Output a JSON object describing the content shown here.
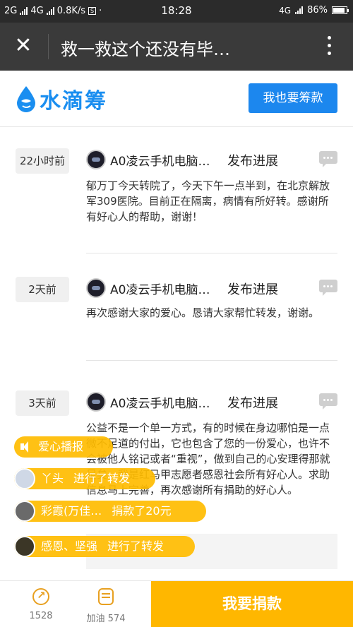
{
  "status_bar": {
    "network_1": "2G",
    "network_2": "4G",
    "speed": "0.8K/s",
    "s_badge": "S",
    "time": "18:28",
    "network_3": "4G",
    "battery": "86%"
  },
  "titlebar": {
    "close_icon": "close-icon",
    "title": "救一救这个还没有毕…",
    "more_icon": "more-vertical-icon"
  },
  "header": {
    "brand": "水滴筹",
    "raise_button": "我也要筹款",
    "accent_color": "#1c87ee"
  },
  "feed": [
    {
      "time": "22小时前",
      "user": "A0凌云手机电脑…",
      "action": "发布进展",
      "text": "郁万丁今天转院了，今天下午一点半到，在北京解放军309医院。目前正在隔离，病情有所好转。感谢所有好心人的帮助，谢谢！"
    },
    {
      "time": "2天前",
      "user": "A0凌云手机电脑…",
      "action": "发布进展",
      "text": "再次感谢大家的爱心。恳请大家帮忙转发，谢谢。"
    },
    {
      "time": "3天前",
      "user": "A0凌云手机电脑…",
      "action": "发布进展",
      "text": "公益不是一个单一方式，有的时候在身边哪怕是一点微不足道的付出，它也包含了您的一份爱心，也许不会被他人铭记或者“重视”，做到自己的心安理得那就足矣。我是红马甲志愿者感恩社会所有好心人。求助信息马上完善，再次感谢所有捐助的好心人。"
    }
  ],
  "broadcast": {
    "title": "爱心播报",
    "items": [
      {
        "name": "丫头",
        "event": "进行了转发"
      },
      {
        "name": "彩霞(万佳…",
        "event": "捐款了20元"
      },
      {
        "name": "感恩、坚强",
        "event": "进行了转发"
      }
    ],
    "pill_color": "#ffbc00"
  },
  "bottom_bar": {
    "share_count": "1528",
    "cheer_label": "加油 574",
    "donate_button": "我要捐款",
    "donate_color": "#ffb700"
  }
}
